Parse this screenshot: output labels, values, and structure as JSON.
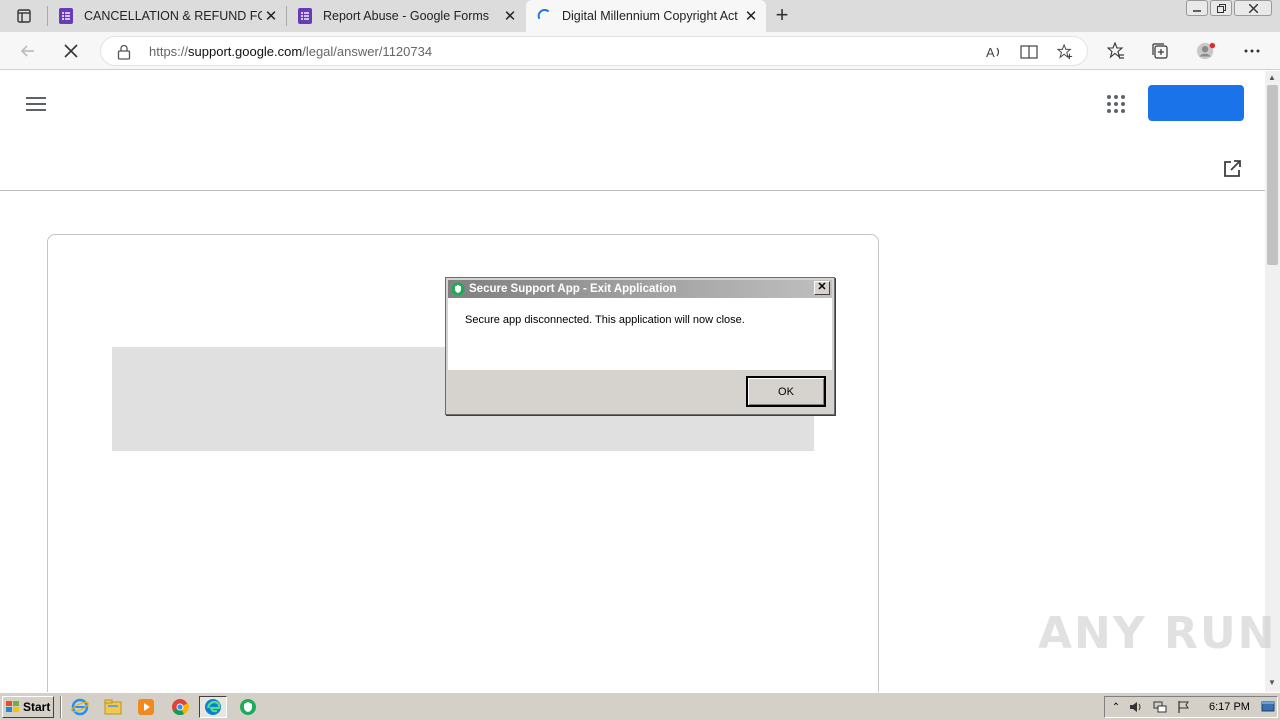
{
  "browser": {
    "tabs": [
      {
        "title": "CANCELLATION & REFUND FOR",
        "icon": "google-forms-icon"
      },
      {
        "title": "Report Abuse - Google Forms",
        "icon": "google-forms-icon"
      },
      {
        "title": "Digital Millennium Copyright Act",
        "icon": "loading-spinner-icon",
        "active": true
      }
    ],
    "new_tab_label": "+",
    "url_prefix": "https://",
    "url_host": "support.google.com",
    "url_path": "/legal/answer/1120734"
  },
  "dialog": {
    "title": "Secure Support App - Exit Application",
    "message": "Secure app disconnected. This application will now close.",
    "ok_label": "OK",
    "close_label": "✕"
  },
  "watermark": "ANY RUN",
  "taskbar": {
    "start_label": "Start",
    "clock": "6:17 PM"
  },
  "colors": {
    "accent_blue": "#1a73e8",
    "forms_purple": "#673ab7"
  }
}
